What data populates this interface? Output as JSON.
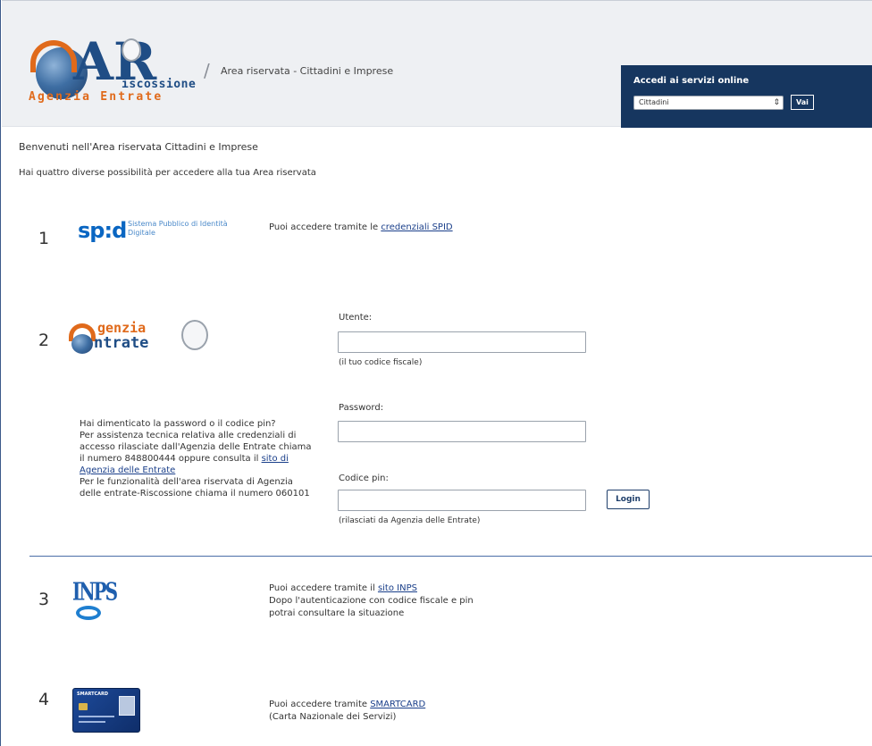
{
  "header": {
    "logo": {
      "letters": "AR",
      "line1": "iscossione",
      "line2": "Agenzia Entrate"
    },
    "breadcrumb": "Area riservata - Cittadini e Imprese",
    "access": {
      "title": "Accedi ai servizi online",
      "selected": "Cittadini",
      "button": "Vai"
    }
  },
  "welcome": "Benvenuti nell'Area riservata Cittadini e Imprese",
  "intro": "Hai quattro diverse possibilità per accedere alla tua Area riservata",
  "options": {
    "spid": {
      "number": "1",
      "logo_word": "sp:d",
      "logo_desc": "Sistema Pubblico di Identità Digitale",
      "text": "Puoi accedere tramite le ",
      "link": "credenziali SPID"
    },
    "agenzia": {
      "number": "2",
      "logo_genzia": "genzia",
      "logo_entrate": "ntrate",
      "utente_label": "Utente:",
      "utente_hint": "(il tuo codice fiscale)",
      "password_label": "Password:",
      "pin_label": "Codice pin:",
      "pin_hint": "(rilasciati da Agenzia delle Entrate)",
      "login": "Login",
      "forgot_1": "Hai dimenticato la password o il codice pin?",
      "forgot_2": "Per assistenza tecnica relativa alle credenziali di accesso rilasciate dall'Agenzia delle Entrate chiama il numero 848800444 oppure consulta il ",
      "forgot_link": "sito di Agenzia delle Entrate",
      "forgot_3": "Per le funzionalità dell'area riservata di Agenzia delle entrate-Riscossione chiama il numero 060101"
    },
    "inps": {
      "number": "3",
      "logo_word": "INPS",
      "text_1": "Puoi accedere tramite il ",
      "link": "sito INPS",
      "text_2": "Dopo l'autenticazione con codice fiscale e pin",
      "text_3": "potrai consultare la situazione"
    },
    "smartcard": {
      "number": "4",
      "card_title": "SMARTCARD",
      "text_1": "Puoi accedere tramite ",
      "link": "SMARTCARD",
      "text_2": "(Carta Nazionale dei Servizi)"
    }
  }
}
